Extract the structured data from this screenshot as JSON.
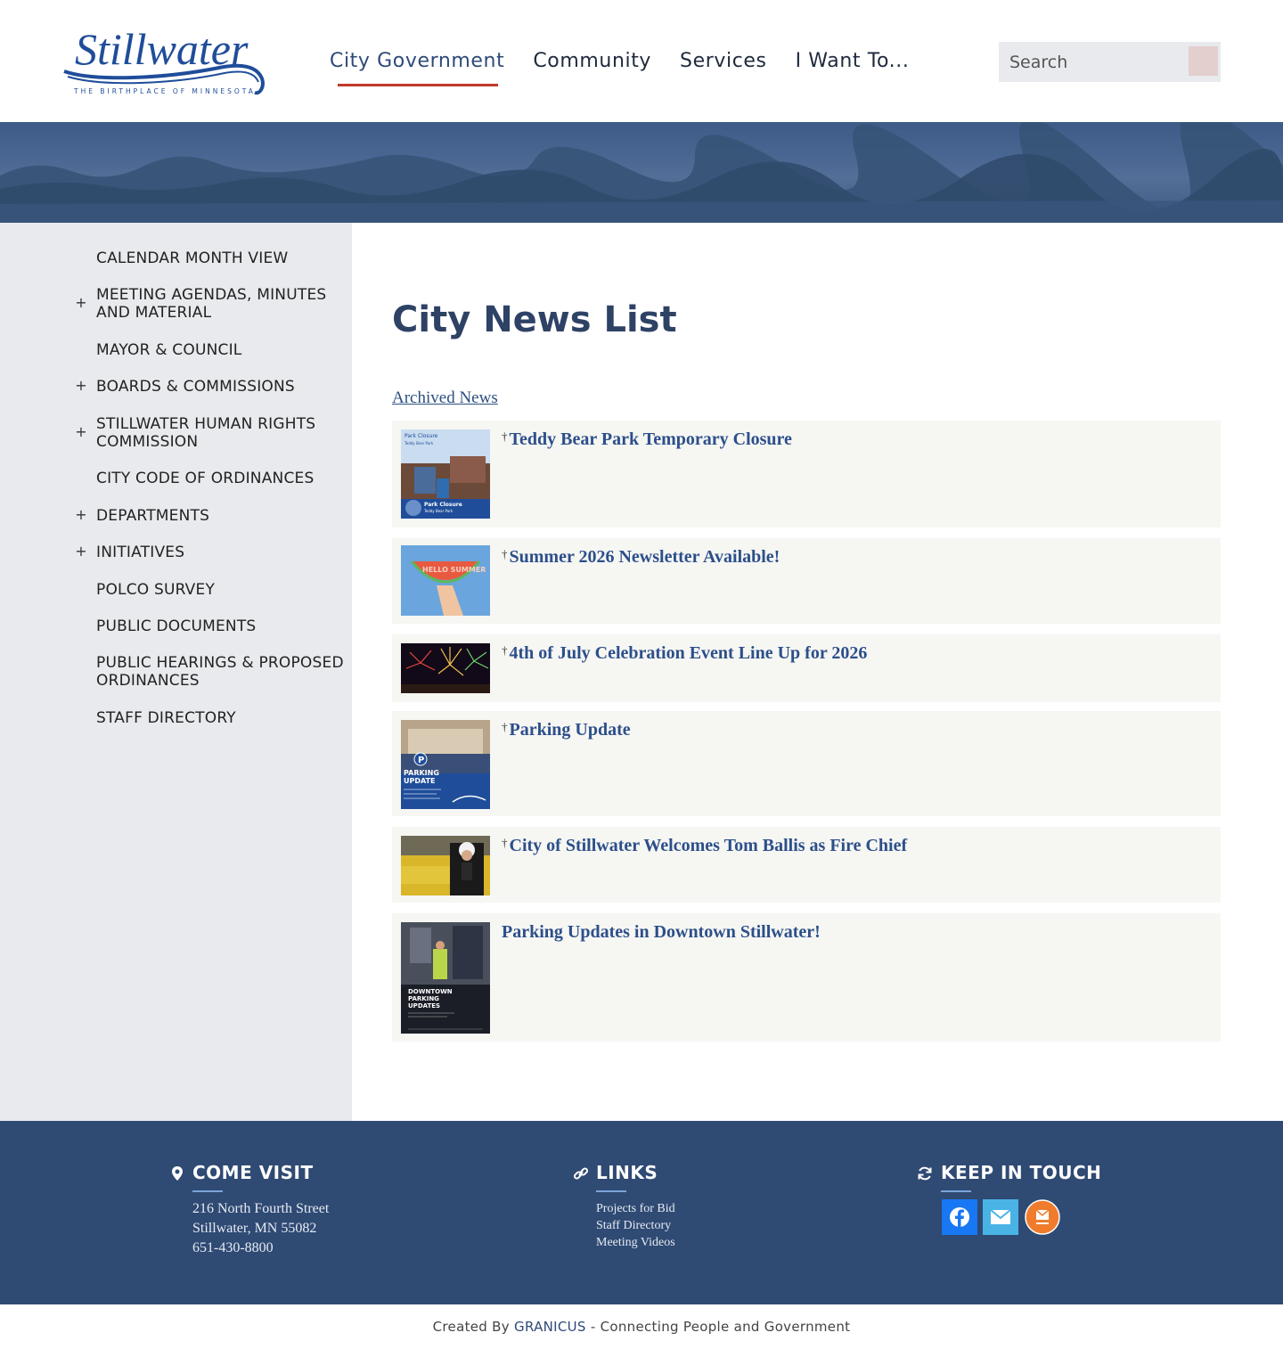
{
  "logo": {
    "wordmark": "Stillwater",
    "tagline": "THE BIRTHPLACE OF MINNESOTA"
  },
  "nav": {
    "items": [
      "City Government",
      "Community",
      "Services",
      "I Want To..."
    ]
  },
  "search": {
    "placeholder": "Search"
  },
  "sidebar": {
    "items": [
      {
        "label": "CALENDAR MONTH VIEW",
        "expandable": false
      },
      {
        "label": "MEETING AGENDAS, MINUTES AND MATERIAL",
        "expandable": true
      },
      {
        "label": "MAYOR & COUNCIL",
        "expandable": false
      },
      {
        "label": "BOARDS & COMMISSIONS",
        "expandable": true
      },
      {
        "label": "STILLWATER HUMAN RIGHTS COMMISSION",
        "expandable": true
      },
      {
        "label": "CITY CODE OF ORDINANCES",
        "expandable": false
      },
      {
        "label": "DEPARTMENTS",
        "expandable": true
      },
      {
        "label": "INITIATIVES",
        "expandable": true
      },
      {
        "label": "POLCO SURVEY",
        "expandable": false
      },
      {
        "label": "PUBLIC DOCUMENTS",
        "expandable": false
      },
      {
        "label": "PUBLIC HEARINGS & PROPOSED ORDINANCES",
        "expandable": false
      },
      {
        "label": "STAFF DIRECTORY",
        "expandable": false
      }
    ],
    "plus": "+"
  },
  "main": {
    "title": "City News List",
    "archived_link": "Archived News",
    "pin_icon": "pushpin-icon",
    "news": [
      {
        "title": "Teddy Bear Park Temporary Closure",
        "pinned": true,
        "thumb_text": [
          "Park Closure",
          "Teddy Bear Park",
          "Park Closure",
          "Teddy Bear Park"
        ]
      },
      {
        "title": "Summer 2026 Newsletter Available!",
        "pinned": true,
        "thumb_text": [
          "HELLO SUMMER"
        ]
      },
      {
        "title": "4th of July Celebration Event Line Up for 2026",
        "pinned": true,
        "thumb_text": []
      },
      {
        "title": "Parking Update",
        "pinned": true,
        "thumb_text": [
          "PARKING",
          "UPDATE"
        ]
      },
      {
        "title": "City of Stillwater Welcomes Tom Ballis as Fire Chief",
        "pinned": true,
        "thumb_text": []
      },
      {
        "title": "Parking Updates in Downtown Stillwater!",
        "pinned": false,
        "thumb_text": [
          "DOWNTOWN",
          "PARKING",
          "UPDATES"
        ]
      }
    ]
  },
  "footer": {
    "visit": {
      "heading": "COME VISIT",
      "icon": "map-pin-icon",
      "address1": "216 North Fourth Street",
      "address2": "Stillwater, MN 55082",
      "phone": "651-430-8800"
    },
    "links": {
      "heading": "LINKS",
      "icon": "link-icon",
      "items": [
        "Projects for Bid",
        "Staff Directory",
        "Meeting Videos"
      ]
    },
    "touch": {
      "heading": "KEEP IN TOUCH",
      "icon": "refresh-icon",
      "social": [
        "facebook-icon",
        "email-icon",
        "newsletter-signup-icon"
      ]
    }
  },
  "bottom": {
    "prefix": "Created By",
    "brand": "GRANICUS",
    "suffix": "- Connecting People and Government"
  },
  "colors": {
    "navy": "#2e4266",
    "accent_red": "#c0392b",
    "footer_bg": "#2f4a73",
    "news_link": "#2c4f8a",
    "facebook": "#1877f2",
    "email": "#4ab3e6",
    "newsletter": "#f07b2c"
  }
}
